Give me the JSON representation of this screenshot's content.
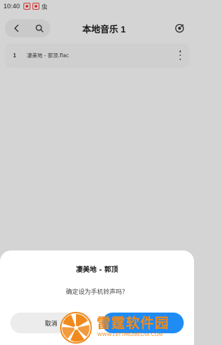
{
  "status_bar": {
    "time": "10:40",
    "icons": [
      "notification-icon",
      "notification-icon",
      "bug-icon"
    ],
    "bug_glyph": "虫"
  },
  "header": {
    "title": "本地音乐 1",
    "icons": [
      "back-icon",
      "search-icon",
      "locate-icon"
    ]
  },
  "songs": [
    {
      "index": "1",
      "title": "凄美地 - 郭顶.flac"
    }
  ],
  "dialog": {
    "title": "凄美地 - 郭顶",
    "message": "确定设为手机铃声吗？",
    "cancel_label": "取消",
    "confirm_label": "",
    "confirm_color": "#1f8bf5"
  },
  "watermark": {
    "name": "雷霆软件园",
    "url": "WWW.LEITINGMEDIA.COM",
    "color": "#f08a1c"
  }
}
